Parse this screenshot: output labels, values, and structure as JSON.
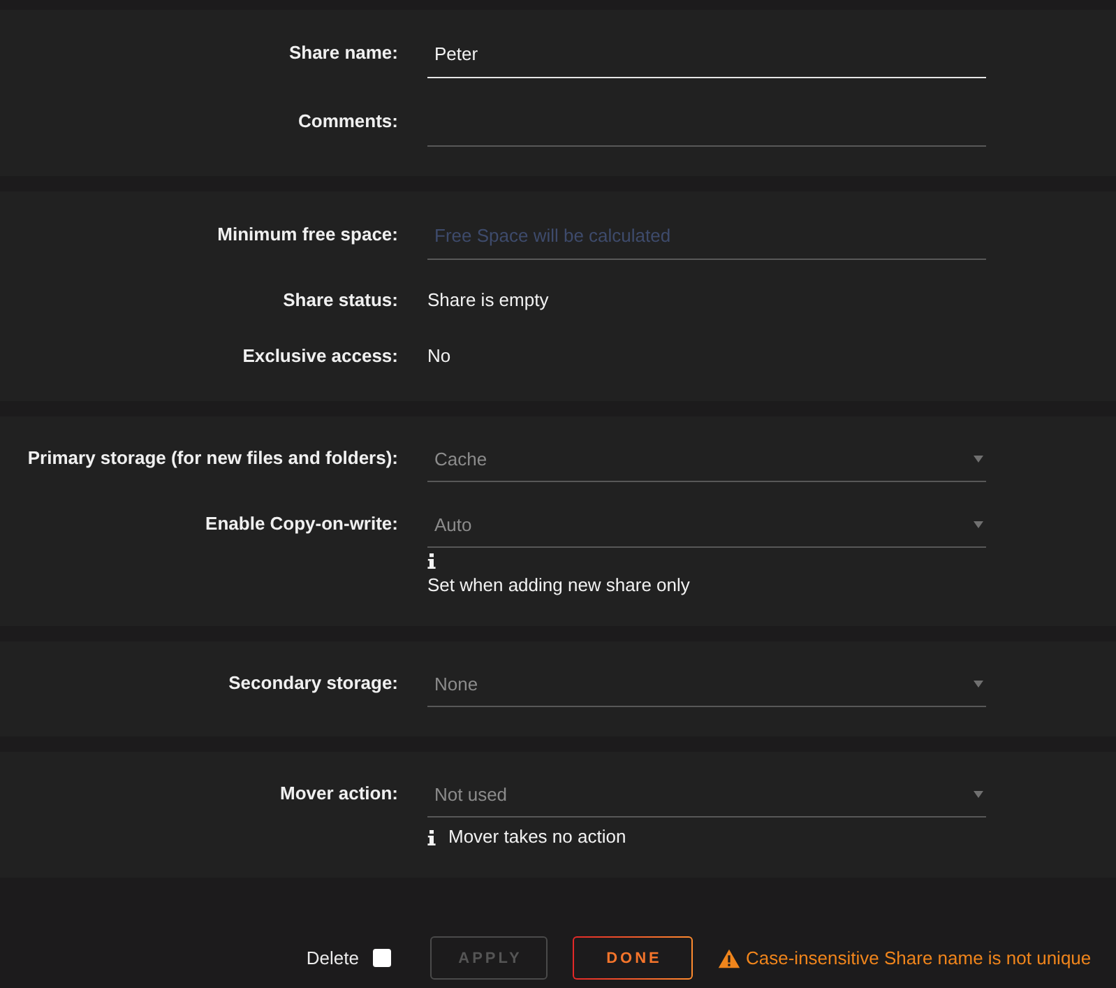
{
  "sections": [
    {
      "rows": [
        {
          "kind": "input",
          "label": "Share name:",
          "value": "Peter",
          "focused": true
        },
        {
          "kind": "input",
          "label": "Comments:",
          "focused": false
        }
      ]
    },
    {
      "rows": [
        {
          "kind": "input",
          "label": "Minimum free space:",
          "placeholder": "Free Space will be calculated",
          "focused": false
        },
        {
          "kind": "text",
          "label": "Share status:",
          "value": "Share is empty"
        },
        {
          "kind": "text",
          "label": "Exclusive access:",
          "value": "No"
        }
      ]
    },
    {
      "rows": [
        {
          "kind": "select",
          "label": "Primary storage (for new files and folders):",
          "value": "Cache"
        },
        {
          "kind": "select",
          "label": "Enable Copy-on-write:",
          "value": "Auto",
          "note": {
            "kind": "below",
            "text": "Set when adding new share only"
          }
        }
      ]
    },
    {
      "rows": [
        {
          "kind": "select",
          "label": "Secondary storage:",
          "value": "None"
        }
      ]
    },
    {
      "rows": [
        {
          "kind": "select",
          "label": "Mover action:",
          "value": "Not used",
          "note": {
            "kind": "inline",
            "text": "Mover takes no action"
          }
        }
      ]
    }
  ],
  "footer": {
    "delete": {
      "label": "Delete",
      "checked": false
    },
    "buttons": [
      {
        "label": "APPLY",
        "disabled": true
      },
      {
        "label": "DONE",
        "disabled": false
      }
    ],
    "warning": "Case-insensitive Share name is not unique"
  }
}
